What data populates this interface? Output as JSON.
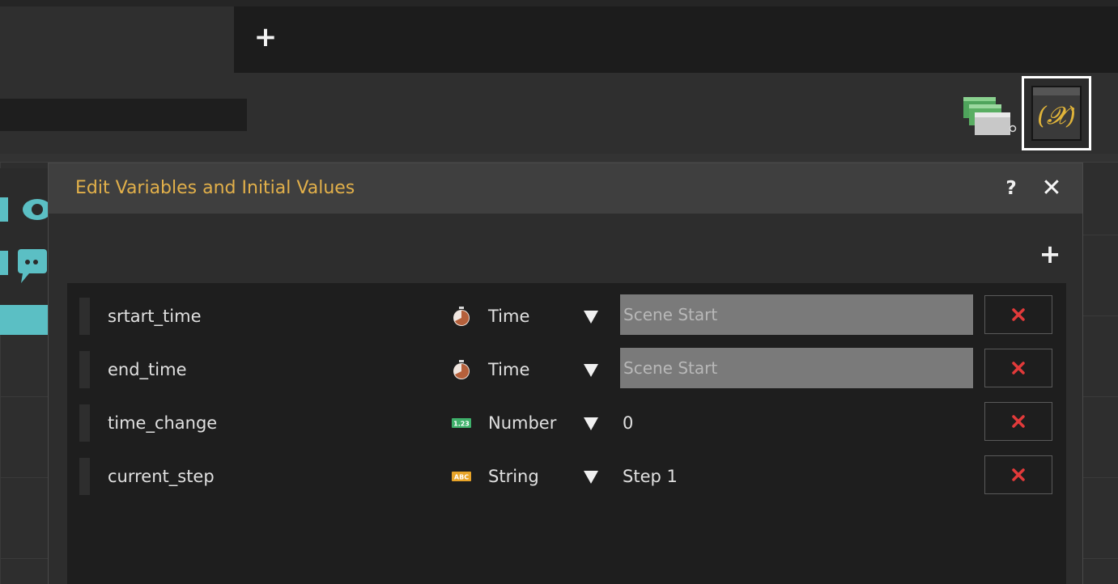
{
  "tabs": {
    "add_label": "+"
  },
  "toolbar": {
    "scenes_icon": "scene-stack-icon",
    "variables_icon": "variables-icon",
    "variables_glyph": "(𝓧)",
    "accent_color": "#e0b43a"
  },
  "dialog": {
    "title": "Edit Variables and Initial Values",
    "help_label": "?",
    "close_label": "✕",
    "add_label": "+",
    "title_color": "#e2b04a",
    "variables": [
      {
        "name": "srtart_time",
        "type": "Time",
        "type_icon": "stopwatch-icon",
        "value": "Scene Start",
        "value_style": "dropdown-box"
      },
      {
        "name": "end_time",
        "type": "Time",
        "type_icon": "stopwatch-icon",
        "value": "Scene Start",
        "value_style": "dropdown-box"
      },
      {
        "name": "time_change",
        "type": "Number",
        "type_icon": "number-icon",
        "value": "0",
        "value_style": "text"
      },
      {
        "name": "current_step",
        "type": "String",
        "type_icon": "string-icon",
        "value": "Step 1",
        "value_style": "text"
      }
    ],
    "delete_icon": "delete-x-icon",
    "delete_color": "#e23a3a"
  }
}
